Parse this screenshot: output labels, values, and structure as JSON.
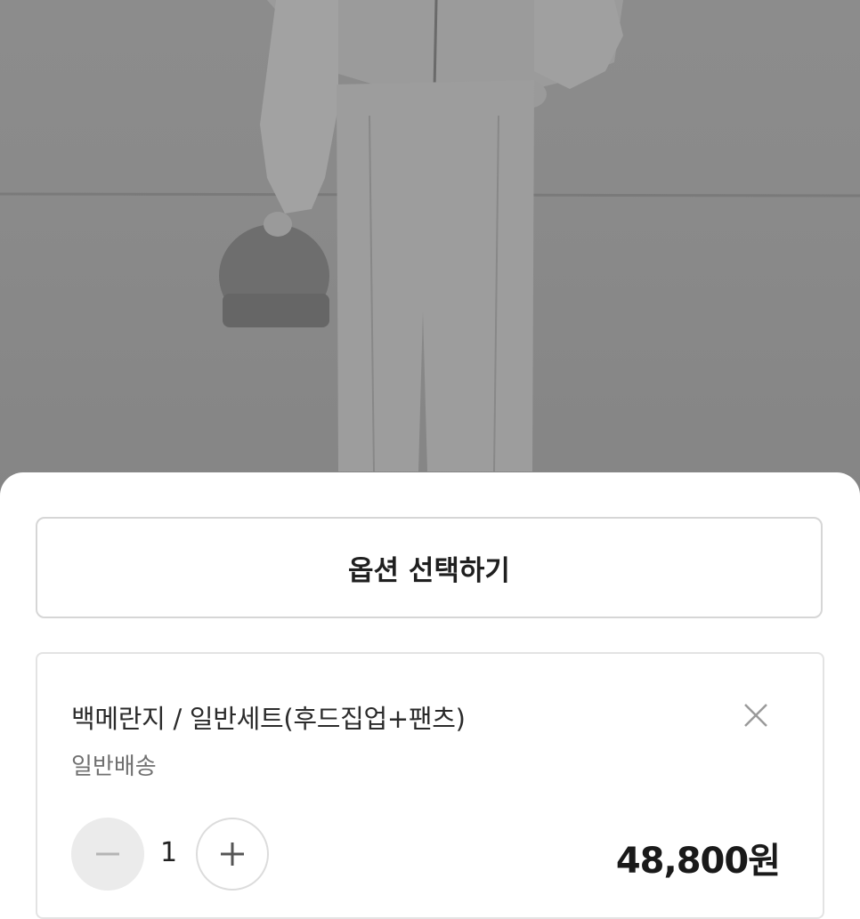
{
  "option_select": {
    "label": "옵션 선택하기"
  },
  "selected_item": {
    "name": "백메란지 / 일반세트(후드집업+팬츠)",
    "shipping": "일반배송",
    "quantity": "1",
    "price": "48,800원"
  },
  "icons": {
    "remove": "close-icon",
    "decrease": "minus-icon",
    "increase": "plus-icon"
  },
  "colors": {
    "photo_bg": "#8a8a8a",
    "sheet_bg": "#ffffff",
    "text_primary": "#1f1f1f",
    "text_secondary": "#707070"
  }
}
